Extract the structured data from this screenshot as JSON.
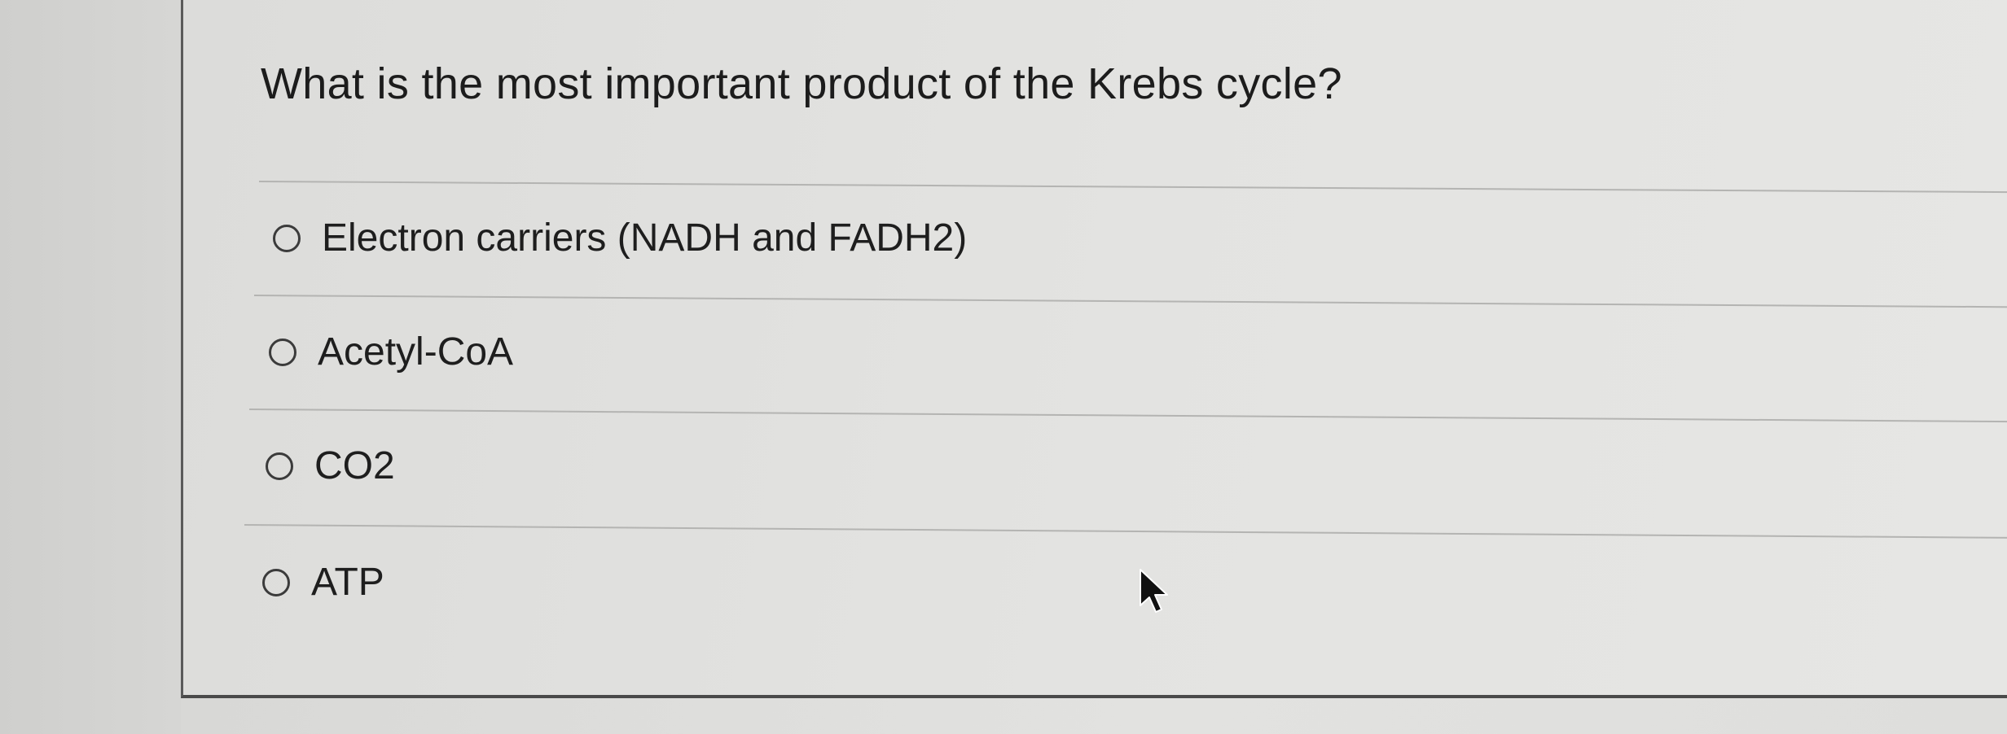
{
  "question": {
    "text": "What is the most important product of the Krebs cycle?"
  },
  "answers": [
    {
      "label": "Electron carriers (NADH and FADH2)",
      "selected": false
    },
    {
      "label": "Acetyl-CoA",
      "selected": false
    },
    {
      "label": "CO2",
      "selected": false
    },
    {
      "label": "ATP",
      "selected": false
    }
  ],
  "icons": {
    "radio": "radio-button-icon",
    "cursor": "mouse-pointer-icon"
  }
}
